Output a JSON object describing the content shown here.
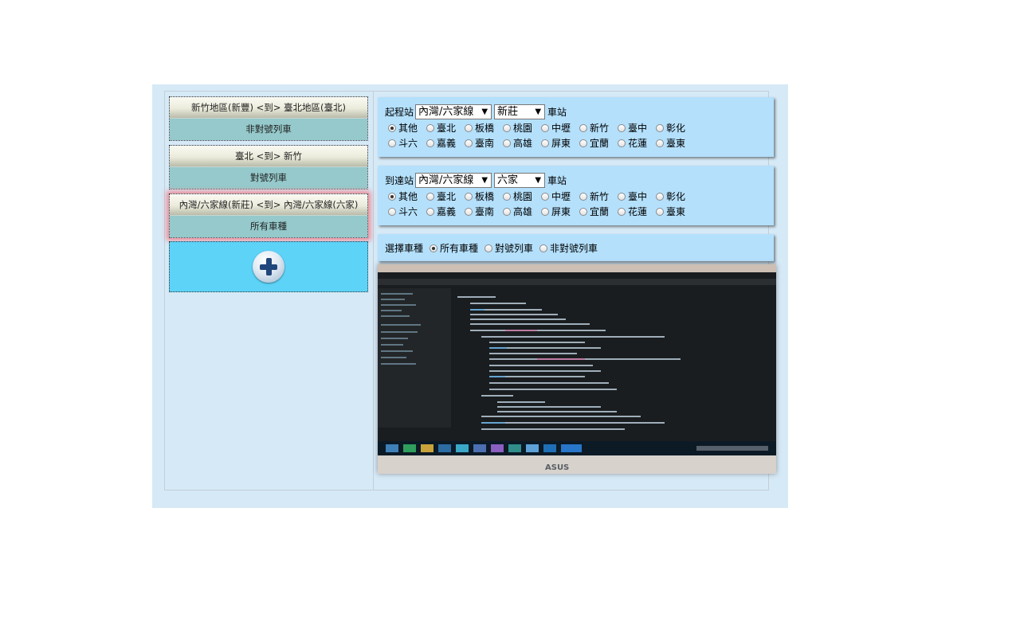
{
  "routes": [
    {
      "route": "新竹地區(新豐) <到> 臺北地區(臺北)",
      "train_type": "非對號列車",
      "selected": false
    },
    {
      "route": "臺北 <到> 新竹",
      "train_type": "對號列車",
      "selected": false
    },
    {
      "route": "內灣/六家線(新莊) <到> 內灣/六家線(六家)",
      "train_type": "所有車種",
      "selected": true
    }
  ],
  "add_route_icon": "plus-icon",
  "departure": {
    "label": "起程站",
    "line_value": "內灣/六家線",
    "station_value": "新莊",
    "suffix": "車站",
    "regions_row1": [
      "其他",
      "臺北",
      "板橋",
      "桃園",
      "中壢",
      "新竹",
      "臺中",
      "彰化"
    ],
    "regions_row2": [
      "斗六",
      "嘉義",
      "臺南",
      "高雄",
      "屏東",
      "宜蘭",
      "花蓮",
      "臺東"
    ],
    "selected_region": "其他"
  },
  "arrival": {
    "label": "到達站",
    "line_value": "內灣/六家線",
    "station_value": "六家",
    "suffix": "車站",
    "regions_row1": [
      "其他",
      "臺北",
      "板橋",
      "桃園",
      "中壢",
      "新竹",
      "臺中",
      "彰化"
    ],
    "regions_row2": [
      "斗六",
      "嘉義",
      "臺南",
      "高雄",
      "屏東",
      "宜蘭",
      "花蓮",
      "臺東"
    ],
    "selected_region": "其他"
  },
  "train_type": {
    "label": "選擇車種",
    "options": [
      "所有車種",
      "對號列車",
      "非對號列車"
    ],
    "selected": "所有車種"
  },
  "photo": {
    "brand_text": "ASUS"
  },
  "colors": {
    "panel": "#b4e0fc",
    "outer": "#d6e9f6",
    "card_bottom": "#95c9cb",
    "add_card": "#5dd3f8",
    "selected_glow": "#f08a95"
  }
}
